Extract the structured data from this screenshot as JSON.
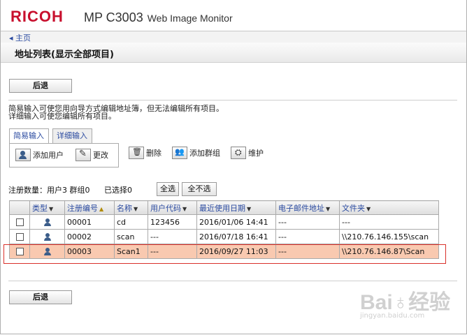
{
  "header": {
    "brand": "RICOH",
    "model": "MP C3003",
    "product": "Web Image Monitor"
  },
  "nav": {
    "home": "◂ 主页"
  },
  "page": {
    "title": "地址列表(显示全部项目)"
  },
  "back_top": "后退",
  "back_bottom": "后退",
  "notes": {
    "line1": "简易输入可使您用向导方式编辑地址簿，但无法编辑所有项目。",
    "line2": "详细输入可使您编辑所有项目。"
  },
  "tabs": {
    "simple": "简易输入",
    "detailed": "详细输入"
  },
  "tools": {
    "add_user": "添加用户",
    "edit": "更改",
    "delete": "删除",
    "add_group": "添加群组",
    "maintenance": "维护"
  },
  "counts": {
    "registered": "注册数量：用户3 群组0",
    "selected": "已选择0"
  },
  "select_all": "全选",
  "deselect_all": "全不选",
  "table": {
    "headers": [
      "类型",
      "注册编号",
      "名称",
      "用户代码",
      "最近使用日期",
      "电子邮件地址",
      "文件夹"
    ],
    "rows": [
      {
        "id": "00001",
        "name": "cd",
        "user_code": "123456",
        "last_used": "2016/01/06 14:41",
        "email": "---",
        "folder": "---"
      },
      {
        "id": "00002",
        "name": "scan",
        "user_code": "---",
        "last_used": "2016/07/18 16:41",
        "email": "---",
        "folder": "\\\\210.76.146.155\\scan"
      },
      {
        "id": "00003",
        "name": "Scan1",
        "user_code": "---",
        "last_used": "2016/09/27 11:03",
        "email": "---",
        "folder": "\\\\210.76.146.87\\Scan"
      }
    ]
  },
  "watermark": {
    "brand": "Bai♁经验",
    "url": "jingyan.baidu.com"
  },
  "colors": {
    "brand_red": "#c8102e",
    "highlight_row": "#f9c9b0",
    "callout_border": "#d9302a",
    "link_blue": "#2a4aa0"
  }
}
